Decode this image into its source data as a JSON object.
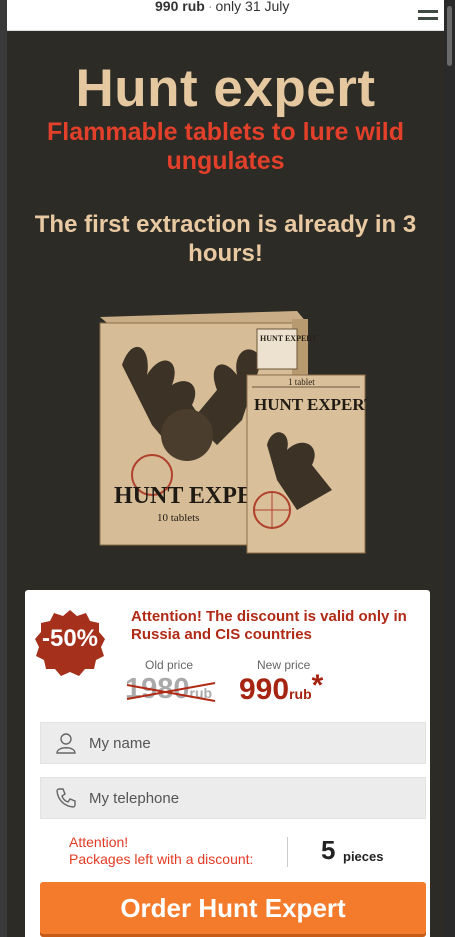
{
  "topbar": {
    "price": "990 rub",
    "separator": "·",
    "offer": "only 31 July"
  },
  "hero": {
    "title": "Hunt expert",
    "subtitle": "Flammable tablets to lure wild ungulates",
    "lead": "The first extraction is already in 3 hours!"
  },
  "product": {
    "box_brand": "HUNT EXPERT",
    "box_count": "10 tablets",
    "sachet_count": "1 tablet",
    "sachet_brand": "HUNT EXPERT",
    "box_header": "HUNT EXPERT"
  },
  "offer": {
    "badge": "-50%",
    "notice": "Attention! The discount is valid only in Russia and CIS countries",
    "old_label": "Old price",
    "old_value": "1980",
    "old_unit": "rub",
    "new_label": "New price",
    "new_value": "990",
    "new_unit": "rub",
    "star": "*"
  },
  "form": {
    "name_placeholder": "My name",
    "phone_placeholder": "My telephone",
    "attention_line1": "Attention!",
    "attention_line2": "Packages left with a discount:",
    "count": "5",
    "count_unit": "pieces",
    "order_label": "Order Hunt Expert"
  },
  "colors": {
    "accent": "#f47a2c",
    "red": "#e2402a",
    "cream": "#e5c8a0",
    "bg": "#2c2b26"
  }
}
